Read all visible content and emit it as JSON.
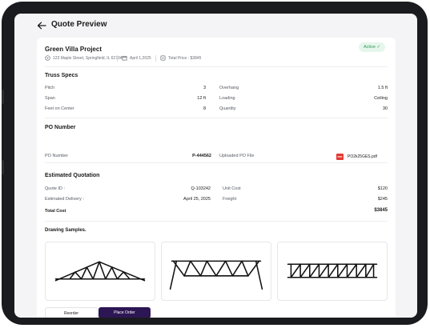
{
  "header": {
    "title": "Quote Preview"
  },
  "project": {
    "name": "Green Villa Project",
    "status": "Active",
    "address": "123 Maple Street, Springfield, IL 62704",
    "date": "April 1,2025",
    "total_price": "Total Price : $3845"
  },
  "truss_specs": {
    "title": "Truss Specs",
    "left": [
      {
        "label": "Pitch",
        "value": "3"
      },
      {
        "label": "Span",
        "value": "12 ft"
      },
      {
        "label": "Feet on Center",
        "value": "8"
      }
    ],
    "right": [
      {
        "label": "Overhang",
        "value": "1.5 ft"
      },
      {
        "label": "Loading",
        "value": "Ceiling"
      },
      {
        "label": "Quantity",
        "value": "30"
      }
    ]
  },
  "po": {
    "title": "PO Number",
    "number_label": "PO Number",
    "number_value": "P-444562",
    "file_label": "Uploaded PO File",
    "file_icon_text": "PDF",
    "file_name": "PO2k25GES.pdf"
  },
  "quotation": {
    "title": "Estimated Quotation",
    "quote_id_label": "Quote ID :",
    "quote_id_value": "Q-103242",
    "delivery_label": "Estimated Delivery :",
    "delivery_value": "April 25, 2025",
    "unit_cost_label": "Unit Cost",
    "unit_cost_value": "$120",
    "freight_label": "Freight",
    "freight_value": "$245",
    "total_label": "Total Cost",
    "total_value": "$3845"
  },
  "drawings": {
    "title": "Drawing Samples."
  },
  "actions": {
    "reorder": "Reorder",
    "place_order": "Place Order"
  },
  "colors": {
    "accent": "#2d1654",
    "status_green": "#2e9a55",
    "status_bg": "#e6f6ec",
    "device": "#1a1b1f",
    "pdf_red": "#e53935"
  },
  "icons": [
    "back-arrow-icon",
    "location-icon",
    "calendar-icon",
    "price-tag-icon",
    "check-icon",
    "pdf-icon"
  ]
}
